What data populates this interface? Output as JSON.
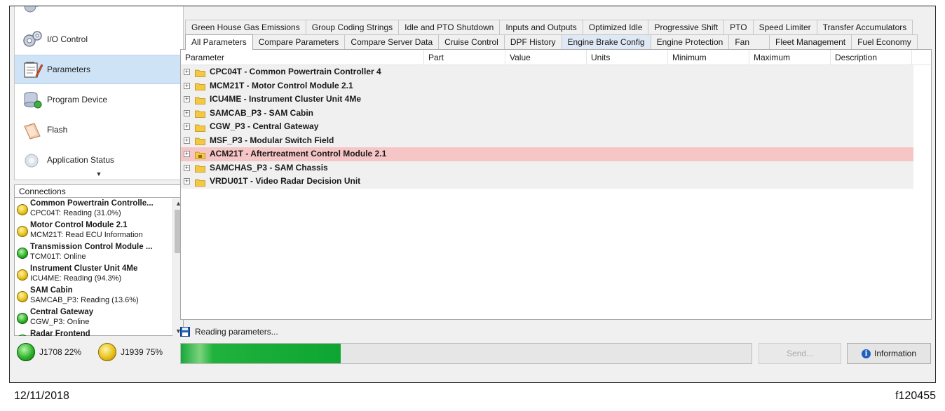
{
  "nav": {
    "items": [
      {
        "label": "I/O Control",
        "icon": "gears-icon",
        "active": false
      },
      {
        "label": "Parameters",
        "icon": "notepad-pencil-icon",
        "active": true
      },
      {
        "label": "Program Device",
        "icon": "database-icon",
        "active": false
      },
      {
        "label": "Flash",
        "icon": "flash-icon",
        "active": false
      },
      {
        "label": "Application Status",
        "icon": "status-icon",
        "active": false
      }
    ]
  },
  "connections": {
    "title": "Connections",
    "items": [
      {
        "name": "Common Powertrain Controlle...",
        "status": "CPC04T: Reading (31.0%)",
        "color": "yellow"
      },
      {
        "name": "Motor Control Module 2.1",
        "status": "MCM21T: Read ECU Information",
        "color": "yellow"
      },
      {
        "name": "Transmission Control Module ...",
        "status": "TCM01T: Online",
        "color": "green"
      },
      {
        "name": "Instrument Cluster Unit 4Me",
        "status": "ICU4ME: Reading (94.3%)",
        "color": "yellow"
      },
      {
        "name": "SAM Cabin",
        "status": "SAMCAB_P3: Reading (13.6%)",
        "color": "yellow"
      },
      {
        "name": "Central Gateway",
        "status": "CGW_P3: Online",
        "color": "green"
      },
      {
        "name": "Radar Frontend",
        "status": "",
        "color": "green"
      }
    ]
  },
  "bus": {
    "j1708": "J1708 22%",
    "j1939": "J1939 75%"
  },
  "tabs_row1": [
    "Green House Gas Emissions",
    "Group Coding Strings",
    "Idle and PTO Shutdown",
    "Inputs and Outputs",
    "Optimized Idle",
    "Progressive Shift",
    "PTO",
    "Speed Limiter",
    "Transfer Accumulators"
  ],
  "tabs_row2": [
    "All Parameters",
    "Compare Parameters",
    "Compare Server Data",
    "Cruise Control",
    "DPF History",
    "Engine Brake Config",
    "Engine Protection",
    "Fan",
    "Fleet Management",
    "Fuel Economy"
  ],
  "grid": {
    "columns": [
      "Parameter",
      "Part",
      "Value",
      "Units",
      "Minimum",
      "Maximum",
      "Description"
    ],
    "rows": [
      "CPC04T - Common Powertrain Controller 4",
      "MCM21T - Motor Control Module 2.1",
      "ICU4ME - Instrument Cluster Unit 4Me",
      "SAMCAB_P3 - SAM Cabin",
      "CGW_P3 - Central Gateway",
      "MSF_P3 - Modular Switch Field",
      "ACM21T - Aftertreatment Control Module 2.1",
      "SAMCHAS_P3 - SAM Chassis",
      "VRDU01T - Video Radar Decision Unit"
    ],
    "selected_row": 6
  },
  "status": {
    "text": "Reading parameters...",
    "progress": 0.28
  },
  "buttons": {
    "send": "Send...",
    "information": "Information"
  },
  "footer": {
    "date": "12/11/2018",
    "figure_id": "f120455"
  },
  "colors": {
    "selected_nav": "#cfe3f7",
    "selected_row": "#f6c6c6",
    "progress": "#15a83a"
  }
}
